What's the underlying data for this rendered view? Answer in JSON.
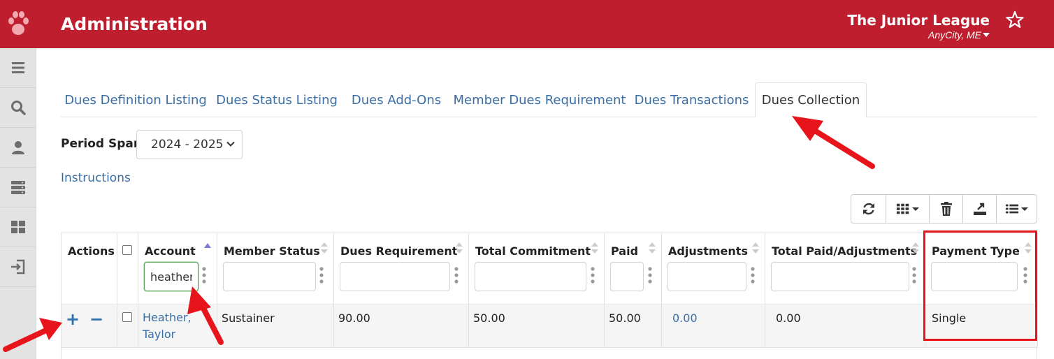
{
  "header": {
    "title": "Administration",
    "org_name": "The Junior League",
    "org_city": "AnyCity, ME",
    "brand_color": "#be1e2d"
  },
  "sidebar": {
    "items": [
      {
        "icon": "menu-icon"
      },
      {
        "icon": "search-icon"
      },
      {
        "icon": "user-icon"
      },
      {
        "icon": "server-icon"
      },
      {
        "icon": "dashboard-icon"
      },
      {
        "icon": "sign-in-icon"
      }
    ]
  },
  "tabs": [
    {
      "label": "Dues Definition Listing",
      "active": false
    },
    {
      "label": "Dues Status Listing",
      "active": false
    },
    {
      "label": "Dues Add-Ons",
      "active": false
    },
    {
      "label": "Member Dues Requirement",
      "active": false
    },
    {
      "label": "Dues Transactions",
      "active": false
    },
    {
      "label": "Dues Collection",
      "active": true
    }
  ],
  "period": {
    "label": "Period Span:",
    "selected": "2024 - 2025"
  },
  "instructions_label": "Instructions",
  "toolbar": {
    "buttons": [
      "refresh-icon",
      "columns-icon",
      "trash-icon",
      "export-icon",
      "list-icon"
    ]
  },
  "table": {
    "headers": {
      "actions": "Actions",
      "account": "Account",
      "member_status": "Member Status",
      "dues_requirement": "Dues Requirement",
      "total_commitment": "Total Commitment",
      "paid": "Paid",
      "adjustments": "Adjustments",
      "total_paid_adjustments": "Total Paid/Adjustments",
      "payment_type": "Payment Type"
    },
    "filters": {
      "account": "heather"
    },
    "rows": [
      {
        "expand": "+",
        "collapse": "−",
        "account_line1": "Heather,",
        "account_line2": "Taylor",
        "member_status": "Sustainer",
        "dues_requirement": "90.00",
        "total_commitment": "50.00",
        "paid": "50.00",
        "adjustments": "0.00",
        "total_paid_adjustments": "0.00",
        "payment_type": "Single"
      }
    ]
  },
  "annotation_color": "#e8141b"
}
